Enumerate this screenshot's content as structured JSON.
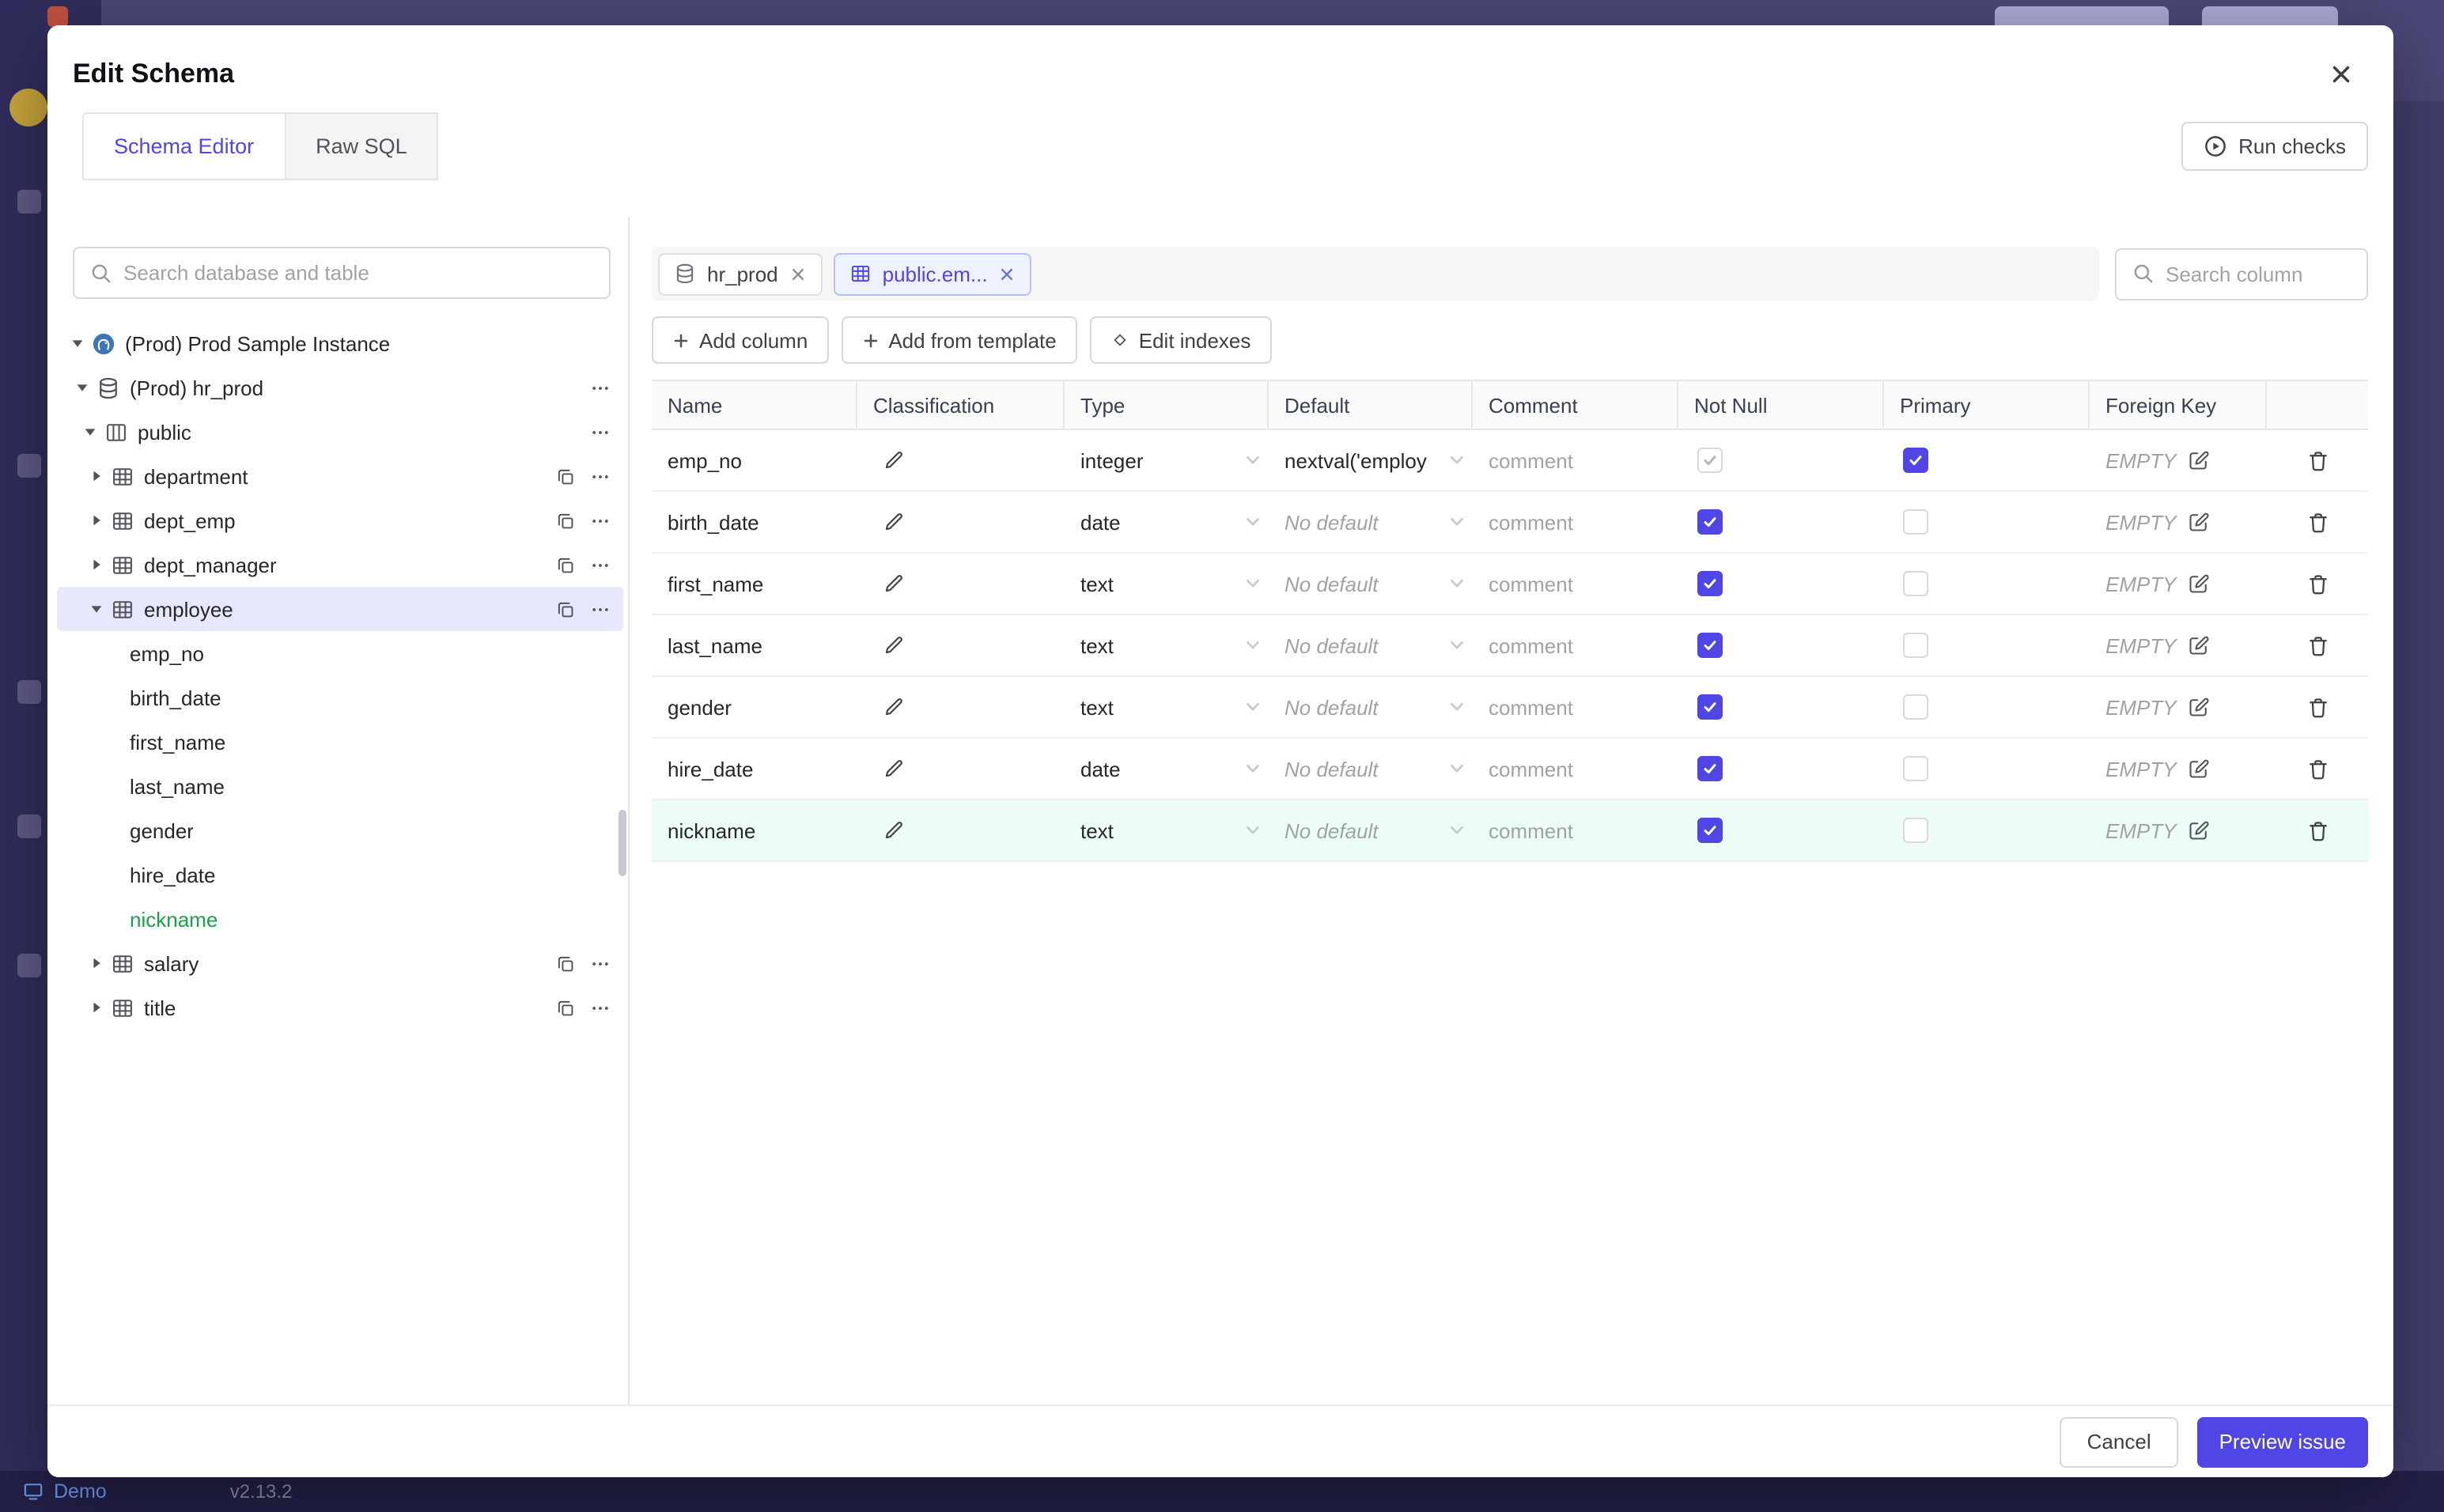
{
  "chrome": {
    "demo_label": "Demo",
    "version": "v2.13.2"
  },
  "modal": {
    "title": "Edit Schema",
    "tabs": [
      {
        "label": "Schema Editor",
        "active": true
      },
      {
        "label": "Raw SQL",
        "active": false
      }
    ],
    "run_checks_label": "Run checks"
  },
  "sidebar": {
    "search_placeholder": "Search database and table",
    "instance": {
      "label": "(Prod) Prod Sample Instance"
    },
    "database": {
      "label": "(Prod) hr_prod"
    },
    "schema": {
      "label": "public"
    },
    "tables": [
      {
        "name": "department"
      },
      {
        "name": "dept_emp"
      },
      {
        "name": "dept_manager"
      },
      {
        "name": "employee",
        "selected": true
      },
      {
        "name": "salary"
      },
      {
        "name": "title"
      }
    ],
    "columns": [
      {
        "name": "emp_no"
      },
      {
        "name": "birth_date"
      },
      {
        "name": "first_name"
      },
      {
        "name": "last_name"
      },
      {
        "name": "gender"
      },
      {
        "name": "hire_date"
      },
      {
        "name": "nickname",
        "added": true
      }
    ]
  },
  "editor": {
    "tabs": [
      {
        "label": "hr_prod",
        "active": false
      },
      {
        "label": "public.em...",
        "active": true
      }
    ],
    "search_placeholder": "Search column",
    "actions": [
      {
        "label": "Add column"
      },
      {
        "label": "Add from template"
      },
      {
        "label": "Edit indexes"
      }
    ],
    "table": {
      "headers": [
        "Name",
        "Classification",
        "Type",
        "Default",
        "Comment",
        "Not Null",
        "Primary",
        "Foreign Key"
      ],
      "comment_placeholder": "comment",
      "rows": [
        {
          "name": "emp_no",
          "type": "integer",
          "default": "nextval('employ",
          "default_muted": false,
          "not_null": true,
          "not_null_disabled": true,
          "primary": true,
          "foreign_key": "EMPTY",
          "added": false
        },
        {
          "name": "birth_date",
          "type": "date",
          "default": "No default",
          "default_muted": true,
          "not_null": true,
          "primary": false,
          "foreign_key": "EMPTY",
          "added": false
        },
        {
          "name": "first_name",
          "type": "text",
          "default": "No default",
          "default_muted": true,
          "not_null": true,
          "primary": false,
          "foreign_key": "EMPTY",
          "added": false
        },
        {
          "name": "last_name",
          "type": "text",
          "default": "No default",
          "default_muted": true,
          "not_null": true,
          "primary": false,
          "foreign_key": "EMPTY",
          "added": false
        },
        {
          "name": "gender",
          "type": "text",
          "default": "No default",
          "default_muted": true,
          "not_null": true,
          "primary": false,
          "foreign_key": "EMPTY",
          "added": false
        },
        {
          "name": "hire_date",
          "type": "date",
          "default": "No default",
          "default_muted": true,
          "not_null": true,
          "primary": false,
          "foreign_key": "EMPTY",
          "added": false
        },
        {
          "name": "nickname",
          "type": "text",
          "default": "No default",
          "default_muted": true,
          "not_null": true,
          "primary": false,
          "foreign_key": "EMPTY",
          "added": true
        }
      ]
    }
  },
  "footer": {
    "cancel_label": "Cancel",
    "preview_label": "Preview issue"
  }
}
